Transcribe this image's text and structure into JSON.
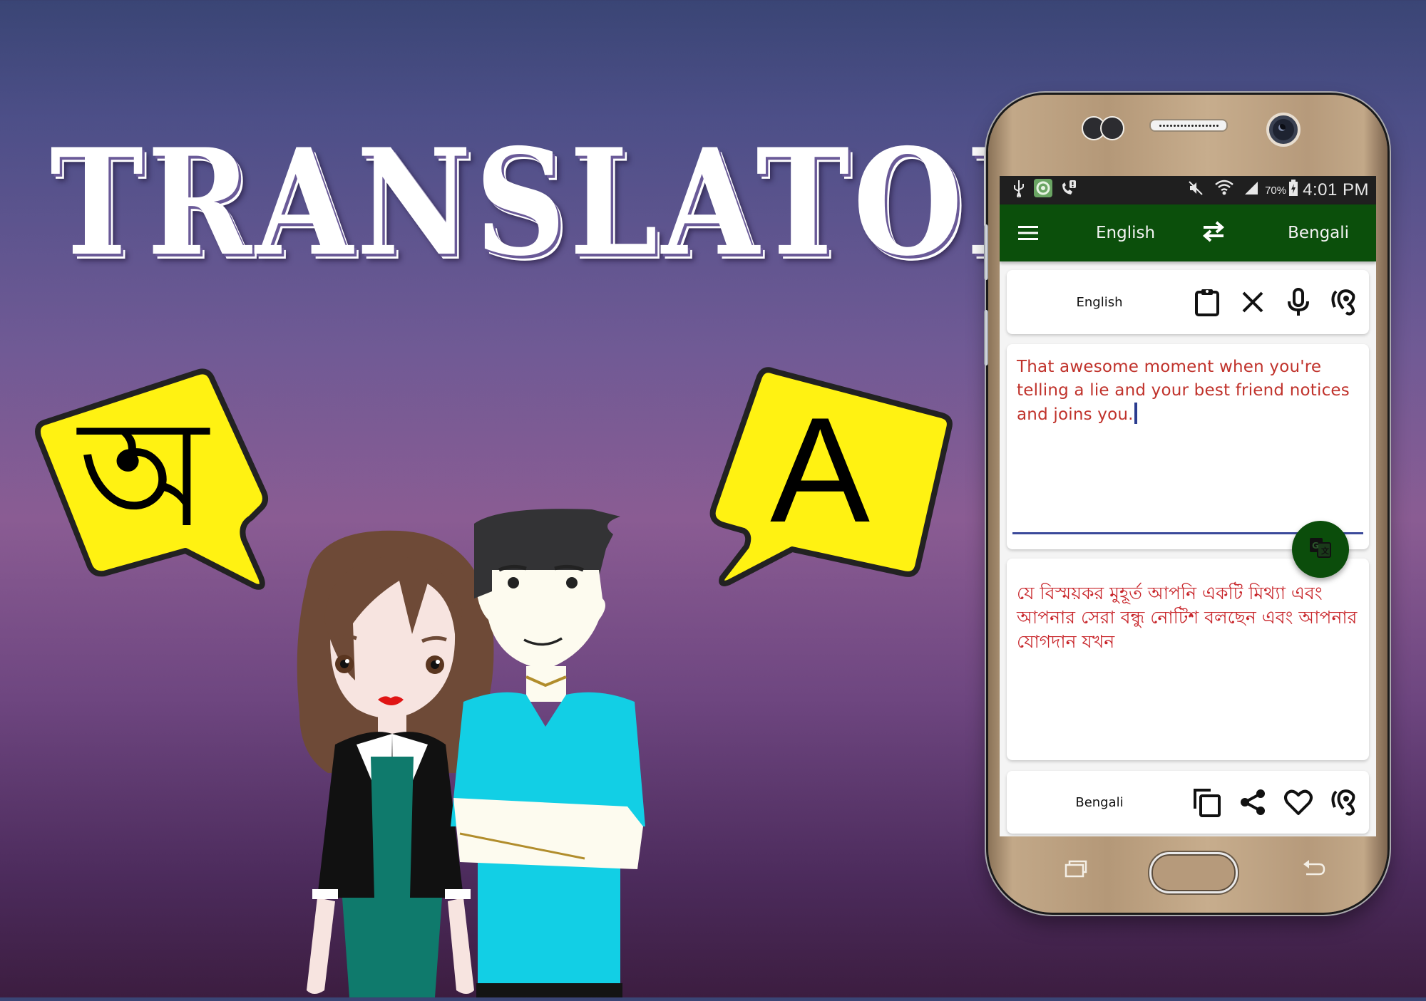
{
  "banner": {
    "title": "TRANSLATOR",
    "bubble_left_letter": "অ",
    "bubble_right_letter": "A"
  },
  "colors": {
    "app_bar": "#0b4f0b",
    "fab": "#0b4d0b",
    "translation_text": "#c8262b",
    "input_text": "#c0322b",
    "bubble_fill": "#fff212"
  },
  "status_bar": {
    "icons_left": [
      "usb-icon",
      "app-notification-icon",
      "call-alert-icon"
    ],
    "icons_right": [
      "mute-icon",
      "wifi-icon",
      "signal-icon"
    ],
    "battery": "70%",
    "time": "4:01 PM"
  },
  "app_bar": {
    "menu_icon": "hamburger-menu-icon",
    "source_language": "English",
    "swap_icon": "swap-arrows-icon",
    "target_language": "Bengali"
  },
  "source_card": {
    "language_label": "English",
    "actions": [
      {
        "name": "paste",
        "icon": "clipboard-icon"
      },
      {
        "name": "clear",
        "icon": "close-icon"
      },
      {
        "name": "voice-input",
        "icon": "microphone-icon"
      },
      {
        "name": "listen",
        "icon": "ear-icon"
      }
    ]
  },
  "input": {
    "value": "That awesome moment when you're telling a lie and your best friend notices and joins you."
  },
  "translate_button": {
    "icon": "google-translate-icon"
  },
  "output": {
    "value": "যে বিস্ময়কর মুহূর্ত আপনি একটি মিথ্যা এবং আপনার সেরা বন্ধু নোটিশ বলছেন এবং আপনার যোগদান যখন"
  },
  "target_card": {
    "language_label": "Bengali",
    "actions": [
      {
        "name": "copy",
        "icon": "copy-icon"
      },
      {
        "name": "share",
        "icon": "share-icon"
      },
      {
        "name": "favorite",
        "icon": "heart-icon"
      },
      {
        "name": "listen",
        "icon": "ear-icon"
      }
    ]
  },
  "phone_nav": {
    "recent_icon": "recent-apps-icon",
    "home_icon": "home-button",
    "back_icon": "back-icon"
  }
}
